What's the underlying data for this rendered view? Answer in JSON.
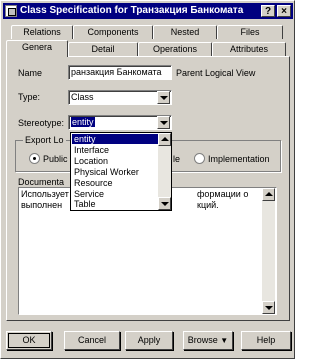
{
  "window": {
    "title": "Class Specification for Транзакция Банкомата",
    "help_glyph": "?",
    "close_glyph": "×"
  },
  "tabs": {
    "row_back": [
      "Relations",
      "Components",
      "Nested",
      "Files"
    ],
    "row_front": [
      "Genera",
      "Detail",
      "Operations",
      "Attributes"
    ],
    "active": "Genera"
  },
  "general": {
    "name_label": "Name",
    "name_value": "ранзакция Банкомата",
    "parent_label": "Parent",
    "parent_value": "Logical View",
    "type_label": "Type:",
    "type_value": "Class",
    "stereotype_label": "Stereotype:",
    "stereotype_value": "entity",
    "export_label": "Export Lo",
    "export_options": {
      "public": "Public",
      "protected_partial": "le",
      "implementation": "Implementation"
    },
    "documentation_label": "Documenta",
    "documentation_left": "Использует\nвыполнен",
    "documentation_right": "формации о\nкций."
  },
  "stereotype_list": [
    "entity",
    "Interface",
    "Location",
    "Physical Worker",
    "Resource",
    "Service",
    "Table"
  ],
  "buttons": {
    "ok": "OK",
    "cancel": "Cancel",
    "apply": "Apply",
    "browse": "Browse",
    "browse_arrow": "▼",
    "help": "Help"
  }
}
